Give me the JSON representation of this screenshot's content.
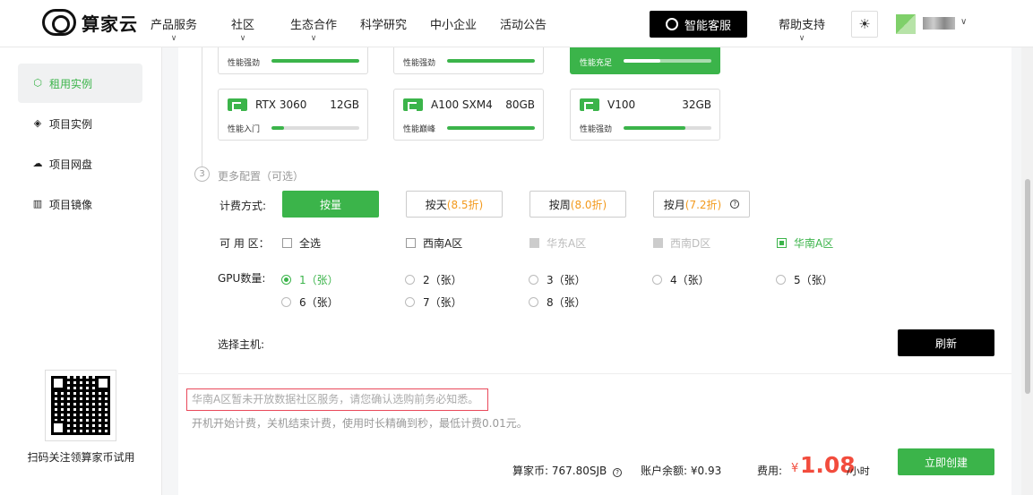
{
  "brand": {
    "name": "算家云"
  },
  "nav": {
    "items": [
      {
        "label": "产品服务",
        "has_dropdown": true
      },
      {
        "label": "社区",
        "has_dropdown": true
      },
      {
        "label": "生态合作",
        "has_dropdown": true
      },
      {
        "label": "科学研究",
        "has_dropdown": false
      },
      {
        "label": "中小企业",
        "has_dropdown": false
      },
      {
        "label": "活动公告",
        "has_dropdown": false
      }
    ],
    "service_button": "智能客服",
    "help": {
      "label": "帮助支持",
      "has_dropdown": true
    }
  },
  "sidebar": {
    "items": [
      {
        "label": "租用实例",
        "icon": "cube-icon",
        "active": true
      },
      {
        "label": "项目实例",
        "icon": "layers-icon",
        "active": false
      },
      {
        "label": "项目网盘",
        "icon": "cloud-disk-icon",
        "active": false
      },
      {
        "label": "项目镜像",
        "icon": "image-icon",
        "active": false
      }
    ],
    "qr_caption": "扫码关注领算家币试用"
  },
  "gpu": {
    "top_row": [
      {
        "perf": "性能强劲",
        "level": 1.0,
        "selected": false
      },
      {
        "perf": "性能强劲",
        "level": 1.0,
        "selected": false
      },
      {
        "perf": "性能充足",
        "level": 0.42,
        "selected": true
      }
    ],
    "cards": [
      {
        "name": "RTX 3060",
        "mem": "12GB",
        "perf": "性能入门",
        "level": 0.14
      },
      {
        "name": "A100 SXM4",
        "mem": "80GB",
        "perf": "性能巅峰",
        "level": 1.0
      },
      {
        "name": "V100",
        "mem": "32GB",
        "perf": "性能强劲",
        "level": 0.7
      }
    ]
  },
  "more_config": {
    "step_number": "3",
    "title": "更多配置（可选）"
  },
  "billing": {
    "label": "计费方式:",
    "options": [
      {
        "label": "按量",
        "discount": "",
        "on": true
      },
      {
        "label": "按天",
        "discount": "(8.5折)",
        "on": false
      },
      {
        "label": "按周",
        "discount": "(8.0折)",
        "on": false
      },
      {
        "label": "按月",
        "discount": "(7.2折)",
        "on": false,
        "help": "?"
      }
    ]
  },
  "region": {
    "label": "可 用 区：",
    "options": [
      {
        "label": "全选",
        "state": "off"
      },
      {
        "label": "西南A区",
        "state": "off"
      },
      {
        "label": "华东A区",
        "state": "disabled"
      },
      {
        "label": "西南D区",
        "state": "disabled"
      },
      {
        "label": "华南A区",
        "state": "on"
      }
    ]
  },
  "gpu_count": {
    "label": "GPU数量:",
    "options": [
      {
        "label": "1（张）",
        "on": true
      },
      {
        "label": "2（张）",
        "on": false
      },
      {
        "label": "3（张）",
        "on": false
      },
      {
        "label": "4（张）",
        "on": false
      },
      {
        "label": "5（张）",
        "on": false
      },
      {
        "label": "6（张）",
        "on": false
      },
      {
        "label": "7（张）",
        "on": false
      },
      {
        "label": "8（张）",
        "on": false
      }
    ]
  },
  "host": {
    "label": "选择主机:",
    "refresh": "刷新"
  },
  "notice": {
    "warning": "华南A区暂未开放数据社区服务，请您确认选购前务必知悉。",
    "billing_note": "开机开始计费，关机结束计费，使用时长精确到秒，最低计费0.01元。"
  },
  "summary": {
    "coins_label": "算家币:",
    "coins_value": "767.80SJB",
    "balance_label": "账户余额:",
    "balance_value": "¥0.93",
    "fee_label": "费用:",
    "currency": "¥",
    "fee_value": "1.08",
    "fee_unit": "/小时",
    "create": "立即创建"
  },
  "colors": {
    "accent": "#3bb44a",
    "price": "#f24c3d",
    "discount": "#f39a1e",
    "warning_border": "#e9495b"
  }
}
